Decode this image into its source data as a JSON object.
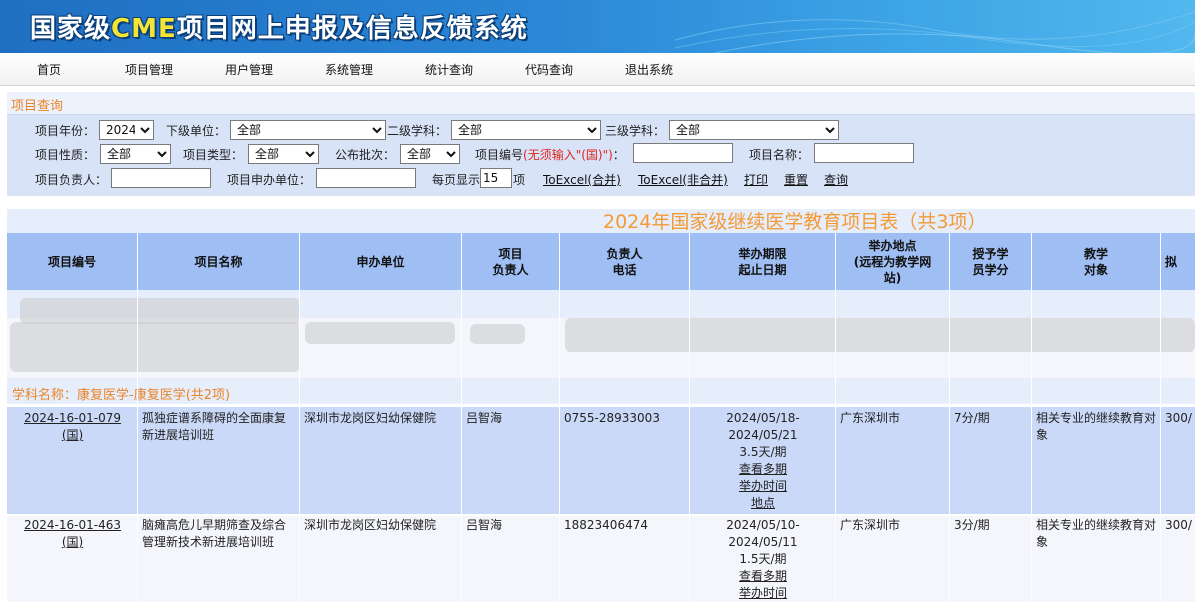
{
  "banner": {
    "title_pre": "国家级",
    "title_cme": "CME",
    "title_post": "项目网上申报及信息反馈系统"
  },
  "menu": [
    "首页",
    "项目管理",
    "用户管理",
    "系统管理",
    "统计查询",
    "代码查询",
    "退出系统"
  ],
  "query": {
    "heading": "项目查询",
    "year_label": "项目年份：",
    "year_value": "2024",
    "sub_unit_label": "下级单位：",
    "sub_unit_value": "全部",
    "level2_label": "二级学科：",
    "level2_value": "全部",
    "level3_label": "三级学科：",
    "level3_value": "全部",
    "nature_label": "项目性质：",
    "nature_value": "全部",
    "type_label": "项目类型：",
    "type_value": "全部",
    "batch_label": "公布批次：",
    "batch_value": "全部",
    "code_label": "项目编号",
    "code_hint": "(无须输入\"(国)\")",
    "code_colon": "：",
    "name_label": "项目名称：",
    "owner_label": "项目负责人：",
    "unit_label": "项目申办单位：",
    "per_page_label": "每页显示",
    "per_page_value": "15",
    "per_page_unit": "项",
    "links": [
      "ToExcel(合并)",
      "ToExcel(非合并)",
      "打印",
      "重置",
      "查询"
    ]
  },
  "table": {
    "title": "2024年国家级继续医学教育项目表（共3项）",
    "headers": [
      {
        "l1": "项目编号",
        "l2": ""
      },
      {
        "l1": "项目名称",
        "l2": ""
      },
      {
        "l1": "申办单位",
        "l2": ""
      },
      {
        "l1": "项目",
        "l2": "负责人"
      },
      {
        "l1": "负责人",
        "l2": "电话"
      },
      {
        "l1": "举办期限",
        "l2": "起止日期"
      },
      {
        "l1": "举办地点",
        "l2": "(远程为教学网",
        "l3": "站)"
      },
      {
        "l1": "授予学",
        "l2": "员学分"
      },
      {
        "l1": "教学",
        "l2": "对象"
      },
      {
        "l1": "拟",
        "l2": ""
      }
    ],
    "subject_group": "学科名称：康复医学-康复医学(共2项)",
    "rows": [
      {
        "code": "2024-16-01-079",
        "code_suffix": "(国)",
        "name": "孤独症谱系障碍的全面康复新进展培训班",
        "unit": "深圳市龙岗区妇幼保健院",
        "owner": "吕智海",
        "phone": "0755-28933003",
        "date_start": "2024/05/18-",
        "date_end": "2024/05/21",
        "days": "3.5天/期",
        "more1": "查看多期",
        "more2": "举办时间",
        "more3": "地点",
        "place": "广东深圳市",
        "credit": "7分/期",
        "target": "相关专业的继续教育对象",
        "extra": "300/"
      },
      {
        "code": "2024-16-01-463",
        "code_suffix": "(国)",
        "name": "脑瘫高危儿早期筛查及综合管理新技术新进展培训班",
        "unit": "深圳市龙岗区妇幼保健院",
        "owner": "吕智海",
        "phone": "18823406474",
        "date_start": "2024/05/10-",
        "date_end": "2024/05/11",
        "days": "1.5天/期",
        "more1": "查看多期",
        "more2": "举办时间",
        "place": "广东深圳市",
        "credit": "3分/期",
        "target": "相关专业的继续教育对象",
        "extra": "300/"
      }
    ]
  }
}
